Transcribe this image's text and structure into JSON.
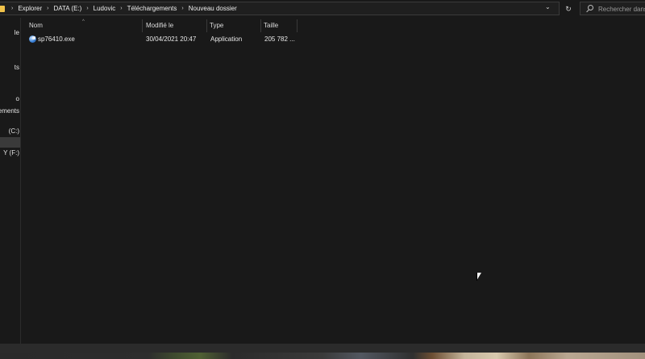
{
  "breadcrumb": [
    "Explorer",
    "DATA (E:)",
    "Ludovic",
    "Téléchargements",
    "Nouveau dossier"
  ],
  "search": {
    "placeholder": "Rechercher dans"
  },
  "nav": {
    "items": [
      {
        "label": "le",
        "selected": false
      },
      {
        "label": "ts",
        "selected": false
      },
      {
        "label": "o",
        "selected": false
      },
      {
        "label": "ements",
        "selected": false
      },
      {
        "label": "(C:)",
        "selected": false
      },
      {
        "label": "",
        "selected": true
      },
      {
        "label": "Y (F:)",
        "selected": false
      }
    ]
  },
  "columns": [
    {
      "key": "name",
      "label": "Nom"
    },
    {
      "key": "modified",
      "label": "Modifié le"
    },
    {
      "key": "type",
      "label": "Type"
    },
    {
      "key": "size",
      "label": "Taille"
    }
  ],
  "files": [
    {
      "name": "sp76410.exe",
      "modified": "30/04/2021 20:47",
      "type": "Application",
      "size": "205 782 ...",
      "icon": "exe-file-icon"
    }
  ],
  "icons": {
    "folder": "folder-icon",
    "separator": "chevron-right-icon",
    "dropdown": "chevron-down-icon",
    "refresh": "refresh-icon",
    "search": "search-icon",
    "sort": "sort-up-icon"
  },
  "theme": {
    "background": "#191919",
    "folder": "#f0c24a",
    "border": "#3a3a3a"
  }
}
